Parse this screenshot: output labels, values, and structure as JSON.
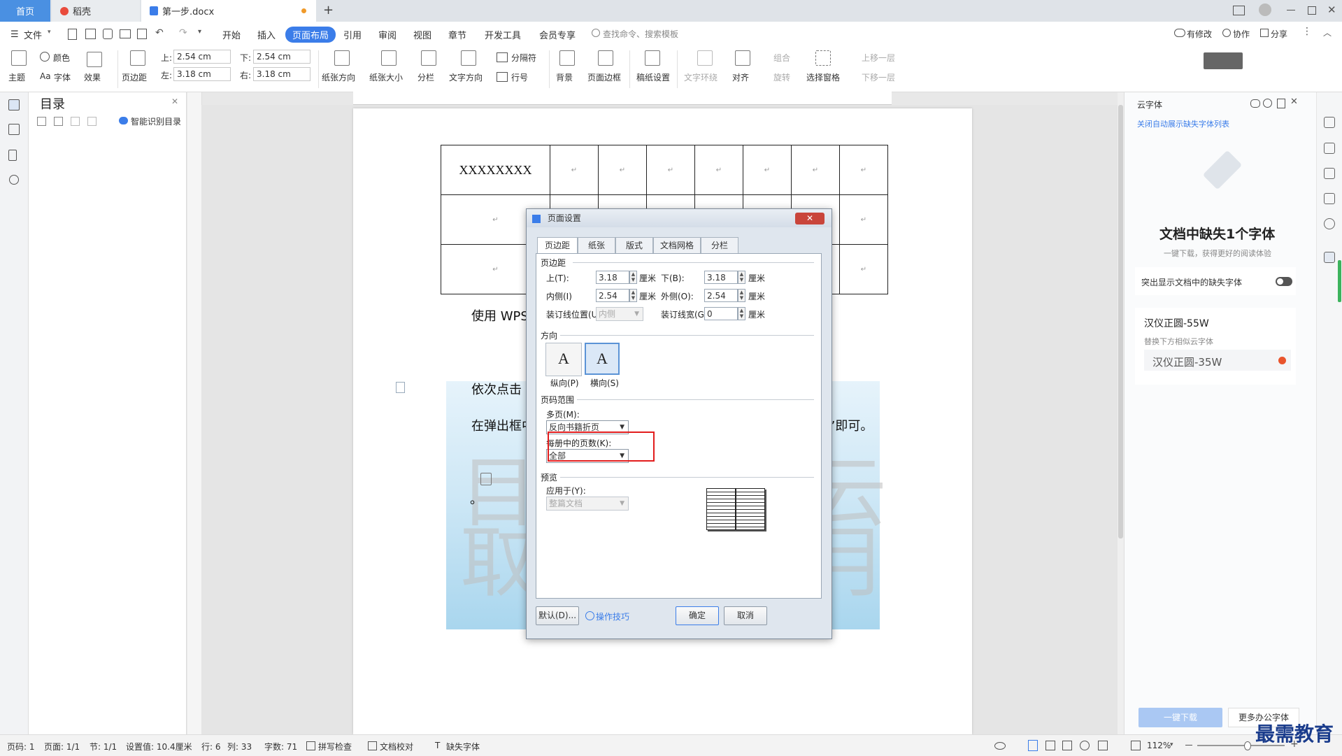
{
  "tabs": {
    "home": "首页",
    "daoke": "稻壳",
    "doc": "第一步.docx"
  },
  "menu": {
    "file": "文件",
    "items": [
      "开始",
      "插入",
      "页面布局",
      "引用",
      "审阅",
      "视图",
      "章节",
      "开发工具",
      "会员专享"
    ],
    "search_placeholder": "查找命令、搜索模板",
    "modified": "有修改",
    "collab": "协作",
    "share": "分享"
  },
  "ribbon": {
    "theme": "主题",
    "color": "颜色",
    "font": "字体",
    "effect": "效果",
    "margin": "页边距",
    "top_label": "上:",
    "top_val": "2.54 cm",
    "bottom_label": "下:",
    "bottom_val": "2.54 cm",
    "left_label": "左:",
    "left_val": "3.18 cm",
    "right_label": "右:",
    "right_val": "3.18 cm",
    "orientation": "纸张方向",
    "size": "纸张大小",
    "columns": "分栏",
    "text_dir": "文字方向",
    "separator": "分隔符",
    "line_no": "行号",
    "background": "背景",
    "page_border": "页面边框",
    "draft": "稿纸设置",
    "wrap": "文字环绕",
    "align": "对齐",
    "group": "组合",
    "rotate": "旋转",
    "select_pane": "选择窗格",
    "up_layer": "上移一层",
    "down_layer": "下移一层"
  },
  "toc": {
    "title": "目录",
    "smart": "智能识别目录"
  },
  "document": {
    "cell_text": "XXXXXXXX",
    "para1": "使用 WPS",
    "para2": "依次点击",
    "para3_left": "在弹出框中",
    "para3_right": "”即可。",
    "dot": "。"
  },
  "dialog": {
    "title": "页面设置",
    "tabs": [
      "页边距",
      "纸张",
      "版式",
      "文档网格",
      "分栏"
    ],
    "margins_section": "页边距",
    "top": "上(T):",
    "top_val": "3.18",
    "bottom": "下(B):",
    "bottom_val": "3.18",
    "inner": "内侧(I)",
    "inner_val": "2.54",
    "outer": "外侧(O):",
    "outer_val": "2.54",
    "gutter_pos": "装订线位置(U):",
    "gutter_pos_val": "内侧",
    "gutter_width": "装订线宽(G):",
    "gutter_width_val": "0",
    "unit": "厘米",
    "orientation_section": "方向",
    "portrait": "纵向(P)",
    "landscape": "横向(S)",
    "range_section": "页码范围",
    "multi_pages": "多页(M):",
    "multi_pages_val": "反向书籍折页",
    "per_booklet": "每册中的页数(K):",
    "per_booklet_val": "全部",
    "preview_section": "预览",
    "apply_to": "应用于(Y):",
    "apply_to_val": "整篇文档",
    "default_btn": "默认(D)...",
    "tips": "操作技巧",
    "ok": "确定",
    "cancel": "取消"
  },
  "right_panel": {
    "title": "云字体",
    "close_list": "关闭自动展示缺失字体列表",
    "missing": "文档中缺失1个字体",
    "subtitle": "一键下载，获得更好的阅读体验",
    "highlight": "突出显示文档中的缺失字体",
    "font_name": "汉仪正圆-55W",
    "replace_hint": "替换下方相似云字体",
    "replacement": "汉仪正圆-35W",
    "download": "一键下载",
    "more": "更多办公字体"
  },
  "status": {
    "page": "页码: 1",
    "pages": "页面: 1/1",
    "section": "节: 1/1",
    "setting": "设置值: 10.4厘米",
    "row": "行: 6",
    "col": "列: 33",
    "words": "字数: 71",
    "spell": "拼写检查",
    "proof": "文档校对",
    "missing_font": "缺失字体",
    "zoom": "112%"
  },
  "watermark": "最需教育"
}
